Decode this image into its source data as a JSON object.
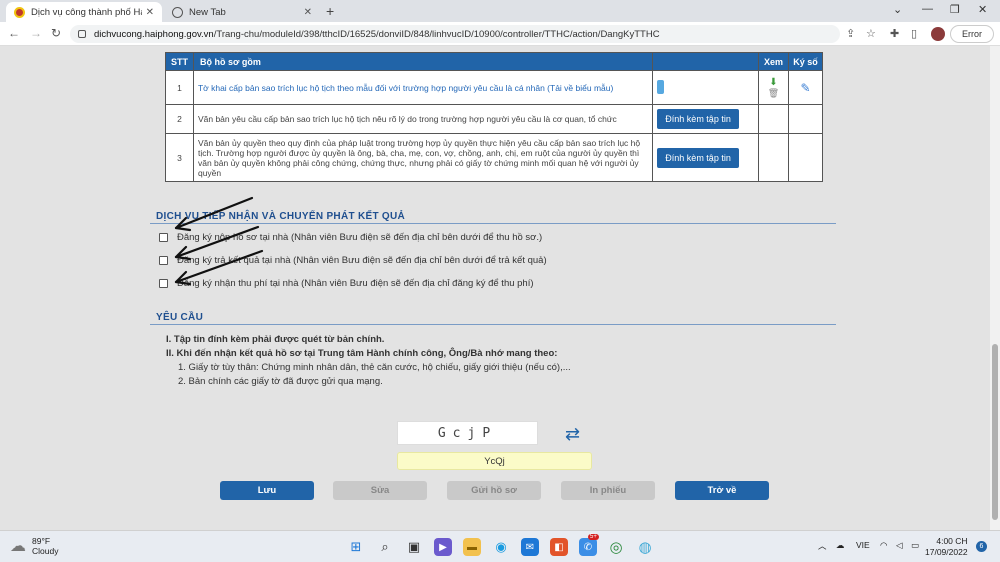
{
  "browser": {
    "tabs": [
      {
        "title": "Dịch vụ công thành phố Hải Phòng"
      },
      {
        "title": "New Tab"
      }
    ],
    "url_host": "dichvucong.haiphong.gov.vn",
    "url_path": "/Trang-chu/moduleId/398/tthcID/16525/donviID/848/linhvucID/10900/controller/TTHC/action/DangKyTTHC",
    "error_label": "Error"
  },
  "table": {
    "headers": {
      "stt": "STT",
      "doc": "Bộ hồ sơ gồm",
      "view": "Xem",
      "sign": "Ký số"
    },
    "rows": [
      {
        "stt": "1",
        "text": "Tờ khai cấp bản sao trích lục hộ tịch theo mẫu đối với trường hợp người yêu cầu là cá nhân (Tải về biểu mẫu)"
      },
      {
        "stt": "2",
        "text": "Văn bản yêu cầu cấp bản sao trích lục hộ tịch nêu rõ lý do trong trường hợp người yêu cầu là cơ quan, tổ chức",
        "button": "Đính kèm tập tin"
      },
      {
        "stt": "3",
        "text": "Văn bản ủy quyền theo quy định của pháp luật trong trường hợp ủy quyền thực hiện yêu cầu cấp bản sao trích lục hộ tịch. Trường hợp người được ủy quyền là ông, bà, cha, mẹ, con, vợ, chồng, anh, chị, em ruột của người ủy quyền thì văn bản ủy quyền không phải công chứng, chứng thực, nhưng phải có giấy tờ chứng minh mối quan hệ với người ủy quyền",
        "button": "Đính kèm tập tin"
      }
    ]
  },
  "services": {
    "title": "DỊCH VỤ TIẾP NHẬN VÀ CHUYỂN PHÁT KẾT QUẢ",
    "options": [
      "Đăng ký nộp hồ sơ tại nhà (Nhân viên Bưu điện sẽ đến địa chỉ bên dưới để thu hồ sơ.)",
      "Đăng ký trả kết quả tại nhà (Nhân viên Bưu điện sẽ đến địa chỉ bên dưới để trả kết quả)",
      "Đăng ký nhận thu phí tại nhà (Nhân viên Bưu điện sẽ đến địa chỉ đăng ký để thu phí)"
    ]
  },
  "requirements": {
    "title": "YÊU CẦU",
    "item1": "I. Tập tin đính kèm phải được quét từ bản chính.",
    "item2": "II. Khi đến nhận kết quả hồ sơ tại Trung tâm Hành chính công, Ông/Bà nhớ mang theo:",
    "sub1": "1. Giấy tờ tùy thân: Chứng minh nhân dân, thẻ căn cước, hộ chiếu, giấy giới thiệu (nếu có),...",
    "sub2": "2. Bản chính các giấy tờ đã được gửi qua mạng."
  },
  "captcha": {
    "code": "GcjP",
    "input_value": "YcQj"
  },
  "actions": {
    "save": "Lưu",
    "edit": "Sửa",
    "submit": "Gửi hồ sơ",
    "print": "In phiếu",
    "back": "Trở về"
  },
  "taskbar": {
    "temp": "89°F",
    "weather": "Cloudy",
    "lang": "VIE",
    "time": "4:00 CH",
    "date": "17/09/2022",
    "badge": "5+",
    "notif_count": "6"
  }
}
